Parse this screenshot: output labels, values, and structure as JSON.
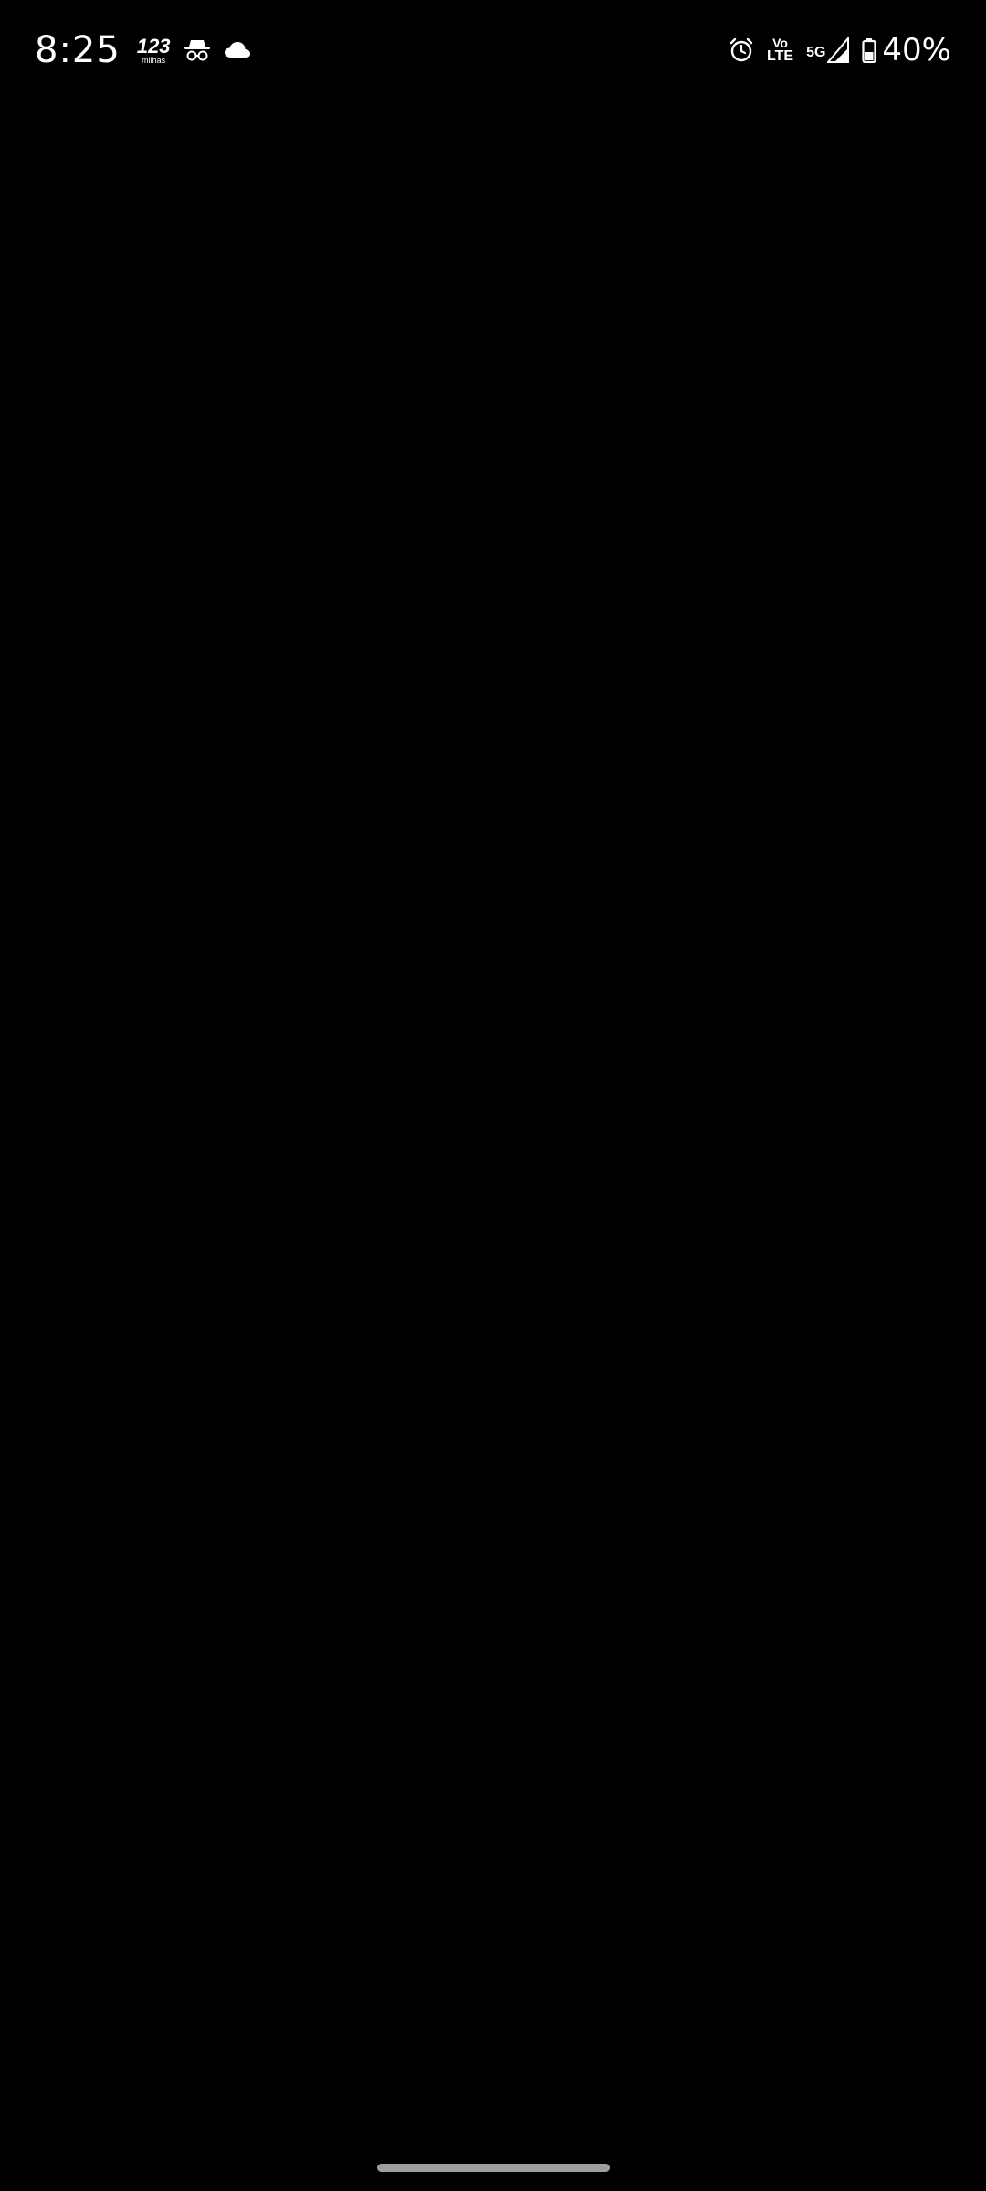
{
  "status_bar": {
    "time": "8:25",
    "badge_number": "123",
    "badge_sub": "milhas",
    "volte_top": "Vo",
    "volte_bottom": "LTE",
    "network_label": "5G",
    "battery_percent": "40%",
    "icons": {
      "incognito": "incognito-icon",
      "cloud": "cloud-icon",
      "alarm": "alarm-icon",
      "signal": "signal-icon",
      "battery": "battery-icon"
    }
  },
  "colors": {
    "background": "#000000",
    "foreground": "#ffffff",
    "home_indicator": "#9e9e9e"
  }
}
